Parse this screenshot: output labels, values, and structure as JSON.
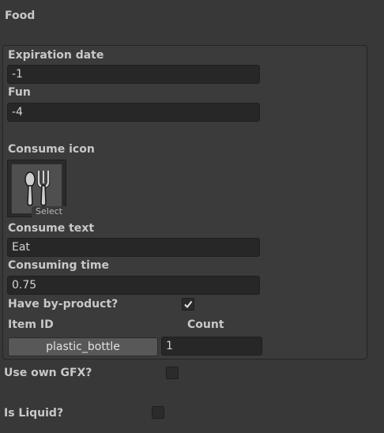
{
  "header": {
    "title": "Food"
  },
  "fields": {
    "expiration_date": {
      "label": "Expiration date",
      "value": "-1"
    },
    "fun": {
      "label": "Fun",
      "value": "-4"
    },
    "consume_icon": {
      "label": "Consume icon",
      "select_label": "Select",
      "icon": "spoon-fork-icon"
    },
    "consume_text": {
      "label": "Consume text",
      "value": "Eat"
    },
    "consuming_time": {
      "label": "Consuming time",
      "value": "0.75"
    },
    "have_byproduct": {
      "label": "Have by-product?",
      "checked": true
    },
    "byproduct": {
      "item_id_label": "Item ID",
      "count_label": "Count",
      "item_id_value": "plastic_bottle",
      "count_value": "1"
    }
  },
  "toggles": {
    "use_own_gfx": {
      "label": "Use own GFX?",
      "checked": false
    },
    "is_liquid": {
      "label": "Is Liquid?",
      "checked": false
    }
  },
  "colors": {
    "background": "#383838",
    "field_bg": "#272727",
    "button_bg": "#585858",
    "text": "#c8c8c8"
  }
}
